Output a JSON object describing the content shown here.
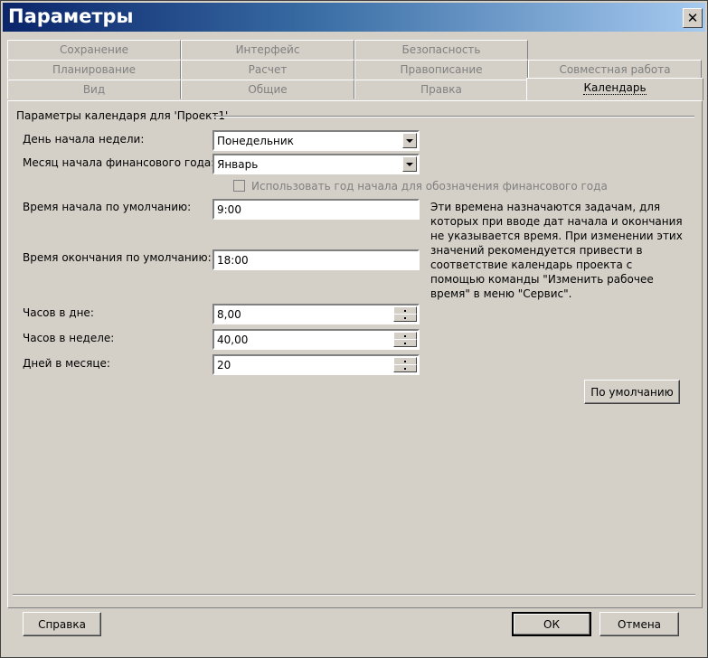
{
  "window": {
    "title": "Параметры",
    "close_symbol": "✕"
  },
  "tabs": {
    "row1": [
      "Сохранение",
      "Интерфейс",
      "Безопасность"
    ],
    "row2": [
      "Планирование",
      "Расчет",
      "Правописание",
      "Совместная работа"
    ],
    "row3": [
      "Вид",
      "Общие",
      "Правка",
      "Календарь"
    ],
    "active": "Календарь"
  },
  "group": {
    "title": "Параметры календаря для 'Проект1'"
  },
  "fields": {
    "week_start": {
      "label": "День начала недели:",
      "value": "Понедельник"
    },
    "fiscal_month": {
      "label": "Месяц начала финансового года:",
      "value": "Январь"
    },
    "fiscal_year_checkbox": {
      "label": "Использовать год начала для обозначения финансового года",
      "checked": false,
      "enabled": false
    },
    "default_start": {
      "label": "Время начала по умолчанию:",
      "value": "9:00"
    },
    "default_end": {
      "label": "Время окончания по умолчанию:",
      "value": "18:00"
    },
    "hours_day": {
      "label": "Часов в дне:",
      "value": "8,00"
    },
    "hours_week": {
      "label": "Часов в неделе:",
      "value": "40,00"
    },
    "days_month": {
      "label": "Дней в месяце:",
      "value": "20"
    }
  },
  "info_text": "Эти времена назначаются задачам, для которых при вводе дат начала и окончания не указывается время. При изменении этих значений рекомендуется привести в соответствие календарь проекта с помощью команды \"Изменить рабочее время\" в меню \"Сервис\".",
  "buttons": {
    "defaults": "По умолчанию",
    "help": "Справка",
    "ok": "ОК",
    "cancel": "Отмена"
  }
}
